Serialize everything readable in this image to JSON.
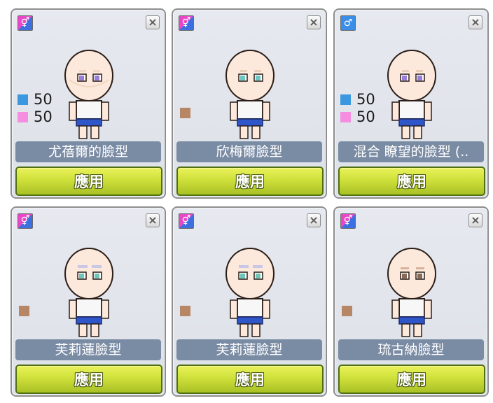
{
  "cards": [
    {
      "gender_icon": "mixed-gender-icon",
      "name": "尤蓓爾的臉型",
      "apply": "應用",
      "mix": [
        {
          "color": "#3a97e0",
          "value": "50"
        },
        {
          "color": "#f58ee0",
          "value": "50"
        }
      ],
      "eye": "#9a7fd8",
      "brow": "#f0d7c3"
    },
    {
      "gender_icon": "mixed-gender-icon",
      "name": "欣梅爾臉型",
      "apply": "應用",
      "swatch": "#b78665",
      "eye": "#6fc6c3",
      "brow": "#e7cdb8"
    },
    {
      "gender_icon": "male-icon",
      "name": "混合 瞭望的臉型 (..",
      "apply": "應用",
      "mix": [
        {
          "color": "#3a97e0",
          "value": "50"
        },
        {
          "color": "#f58ee0",
          "value": "50"
        }
      ],
      "eye": "#9a7fd8",
      "brow": "#e7cdb8"
    },
    {
      "gender_icon": "mixed-gender-icon",
      "name": "芙莉蓮臉型",
      "apply": "應用",
      "swatch": "#b78665",
      "eye": "#6fc6b6",
      "brow": "#c9c6e6"
    },
    {
      "gender_icon": "mixed-gender-icon",
      "name": "芙莉蓮臉型",
      "apply": "應用",
      "swatch": "#b78665",
      "eye": "#6fc6b6",
      "brow": "#c9c6e6"
    },
    {
      "gender_icon": "mixed-gender-icon",
      "name": "琉古納臉型",
      "apply": "應用",
      "swatch": "#b78665",
      "eye": "#8a6a55",
      "brow": "#d8b29a"
    }
  ]
}
